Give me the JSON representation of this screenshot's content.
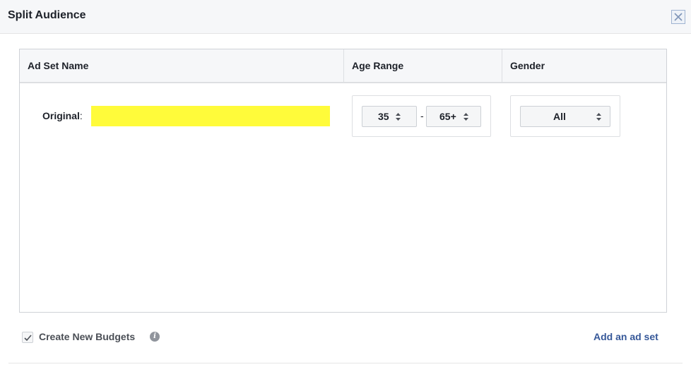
{
  "dialog": {
    "title": "Split Audience",
    "close_icon": "close-icon"
  },
  "table": {
    "columns": [
      "Ad Set Name",
      "Age Range",
      "Gender"
    ],
    "row": {
      "label": "Original",
      "separator": ":",
      "name_redacted": true,
      "age_min": "35",
      "age_dash": "-",
      "age_max": "65+",
      "gender": "All"
    }
  },
  "footer": {
    "checkbox_checked": true,
    "checkbox_label": "Create New Budgets",
    "info_icon": "info-icon",
    "info_glyph": "i",
    "add_link": "Add an ad set"
  },
  "colors": {
    "link": "#365899",
    "redaction": "#fffb3a",
    "header_bg": "#f6f7f9"
  }
}
